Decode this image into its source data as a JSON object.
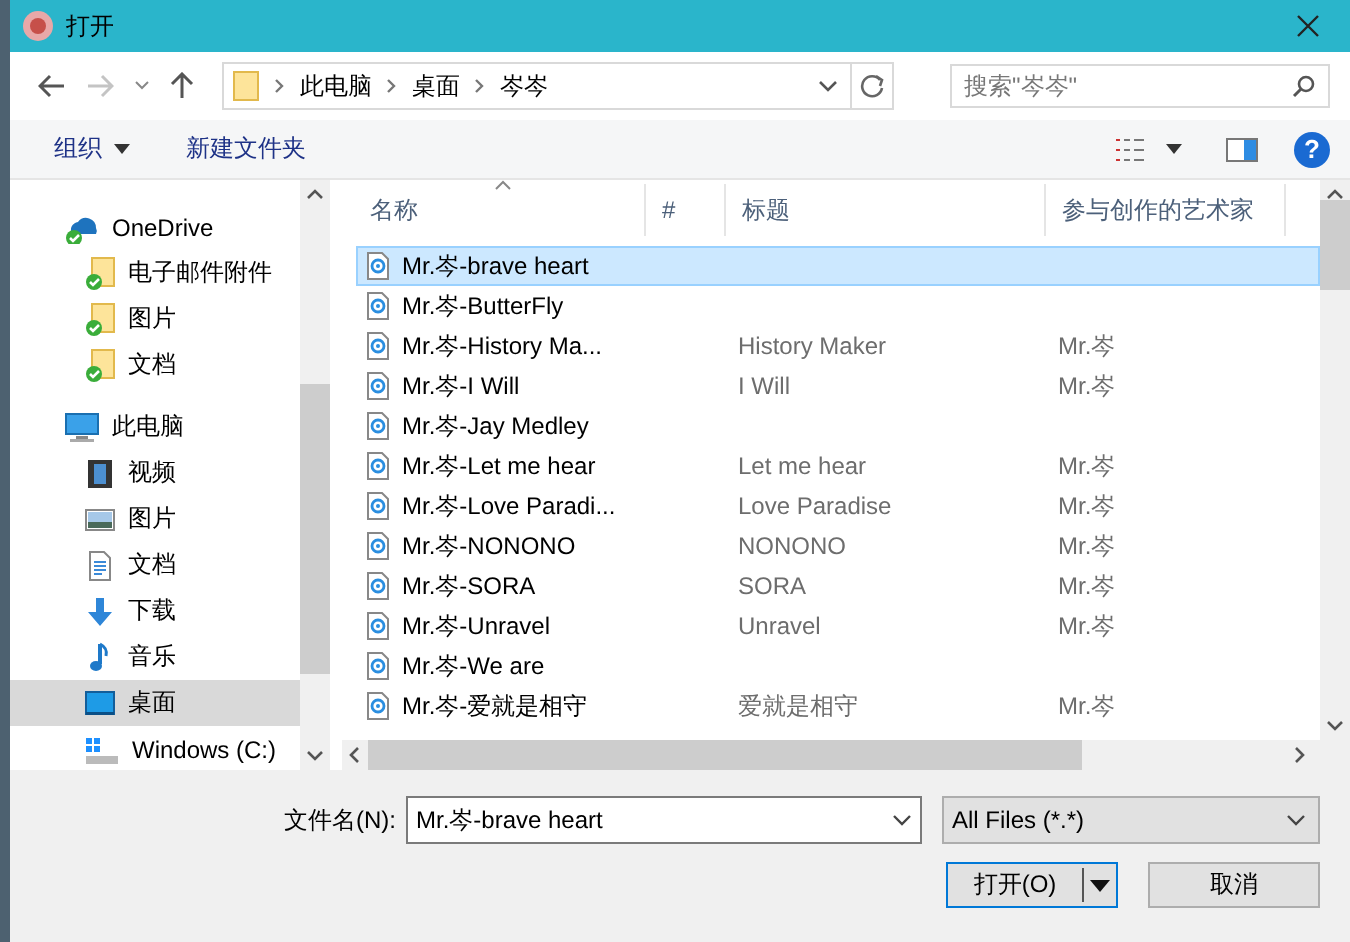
{
  "window": {
    "title": "打开"
  },
  "nav": {
    "path": [
      "此电脑",
      "桌面",
      "岑岑"
    ],
    "search": {
      "placeholder": "搜索\"岑岑\""
    }
  },
  "toolbar": {
    "organize": "组织",
    "new_folder": "新建文件夹",
    "help": "?"
  },
  "sidebar": {
    "items": [
      {
        "label": "OneDrive",
        "kind": "onedrive",
        "selected": false,
        "children": [
          {
            "label": "电子邮件附件",
            "kind": "synced-folder",
            "selected": false
          },
          {
            "label": "图片",
            "kind": "synced-folder",
            "selected": false
          },
          {
            "label": "文档",
            "kind": "synced-folder",
            "selected": false
          }
        ]
      },
      {
        "label": "此电脑",
        "kind": "computer",
        "selected": false,
        "children": [
          {
            "label": "视频",
            "kind": "video",
            "selected": false
          },
          {
            "label": "图片",
            "kind": "pictures",
            "selected": false
          },
          {
            "label": "文档",
            "kind": "documents",
            "selected": false
          },
          {
            "label": "下载",
            "kind": "downloads",
            "selected": false
          },
          {
            "label": "音乐",
            "kind": "music",
            "selected": false
          },
          {
            "label": "桌面",
            "kind": "desktop",
            "selected": true
          },
          {
            "label": "Windows (C:)",
            "kind": "drive",
            "selected": false
          }
        ]
      }
    ]
  },
  "table": {
    "columns": [
      "名称",
      "#",
      "标题",
      "参与创作的艺术家"
    ],
    "rows": [
      {
        "name": "Mr.岑-brave heart",
        "selected": true
      },
      {
        "name": "Mr.岑-ButterFly",
        "selected": false
      },
      {
        "name": "Mr.岑-History Ma...",
        "title": "History Maker",
        "artist": "Mr.岑",
        "selected": false
      },
      {
        "name": "Mr.岑-I Will",
        "title": "I Will",
        "artist": "Mr.岑",
        "selected": false
      },
      {
        "name": "Mr.岑-Jay Medley",
        "selected": false
      },
      {
        "name": "Mr.岑-Let me hear",
        "title": "Let me hear",
        "artist": "Mr.岑",
        "selected": false
      },
      {
        "name": "Mr.岑-Love Paradi...",
        "title": "Love Paradise",
        "artist": "Mr.岑",
        "selected": false
      },
      {
        "name": "Mr.岑-NONONO",
        "title": "NONONO",
        "artist": "Mr.岑",
        "selected": false
      },
      {
        "name": "Mr.岑-SORA",
        "title": "SORA",
        "artist": "Mr.岑",
        "selected": false
      },
      {
        "name": "Mr.岑-Unravel",
        "title": "Unravel",
        "artist": "Mr.岑",
        "selected": false
      },
      {
        "name": "Mr.岑-We are",
        "selected": false
      },
      {
        "name": "Mr.岑-爱就是相守",
        "title": "爱就是相守",
        "artist": "Mr.岑",
        "selected": false
      }
    ]
  },
  "footer": {
    "filename_label": "文件名(N):",
    "filename": "Mr.岑-brave heart",
    "filter": "All Files (*.*)",
    "open_button": "打开(O)",
    "cancel_button": "取消"
  }
}
